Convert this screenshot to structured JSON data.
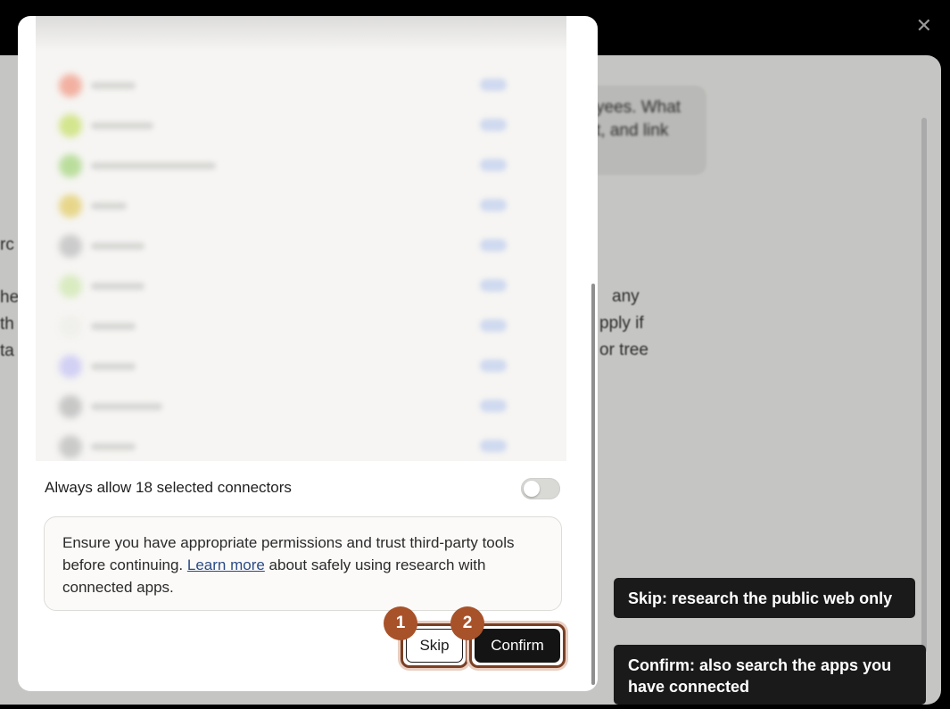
{
  "background": {
    "bubble_lines": [
      "yees. What",
      "t, and link"
    ],
    "body_lines": [
      "any",
      "pply if",
      "or tree"
    ],
    "left_fragments": [
      "rc",
      "he",
      "th",
      "ta"
    ]
  },
  "connectors": {
    "icon_colors": [
      "#f19a86",
      "#c8e06c",
      "#a6d680",
      "#e2cc68",
      "#bdbdbd",
      "#d0e8b0",
      "#eeeeea",
      "#c6c4f4",
      "#b8b8b8",
      "#bcbcbc"
    ],
    "name_widths": [
      50,
      70,
      140,
      40,
      60,
      60,
      50,
      50,
      80,
      50
    ]
  },
  "always_allow": {
    "label": "Always allow 18 selected connectors",
    "enabled": false
  },
  "notice": {
    "text_before": "Ensure you have appropriate permissions and trust third-party tools before continuing. ",
    "link": "Learn more",
    "text_after": " about safely using research with connected apps."
  },
  "buttons": {
    "skip": "Skip",
    "confirm": "Confirm"
  },
  "badges": {
    "skip_step": "1",
    "confirm_step": "2"
  },
  "tooltips": {
    "skip": "Skip: research the public web only",
    "confirm": "Confirm: also search the apps you have connected"
  },
  "icons": {
    "close": "close-icon",
    "mic": "microphone-icon"
  },
  "colors": {
    "accent_badge": "#a8522a",
    "ring": "#7a3f24",
    "link": "#2c4a86"
  }
}
